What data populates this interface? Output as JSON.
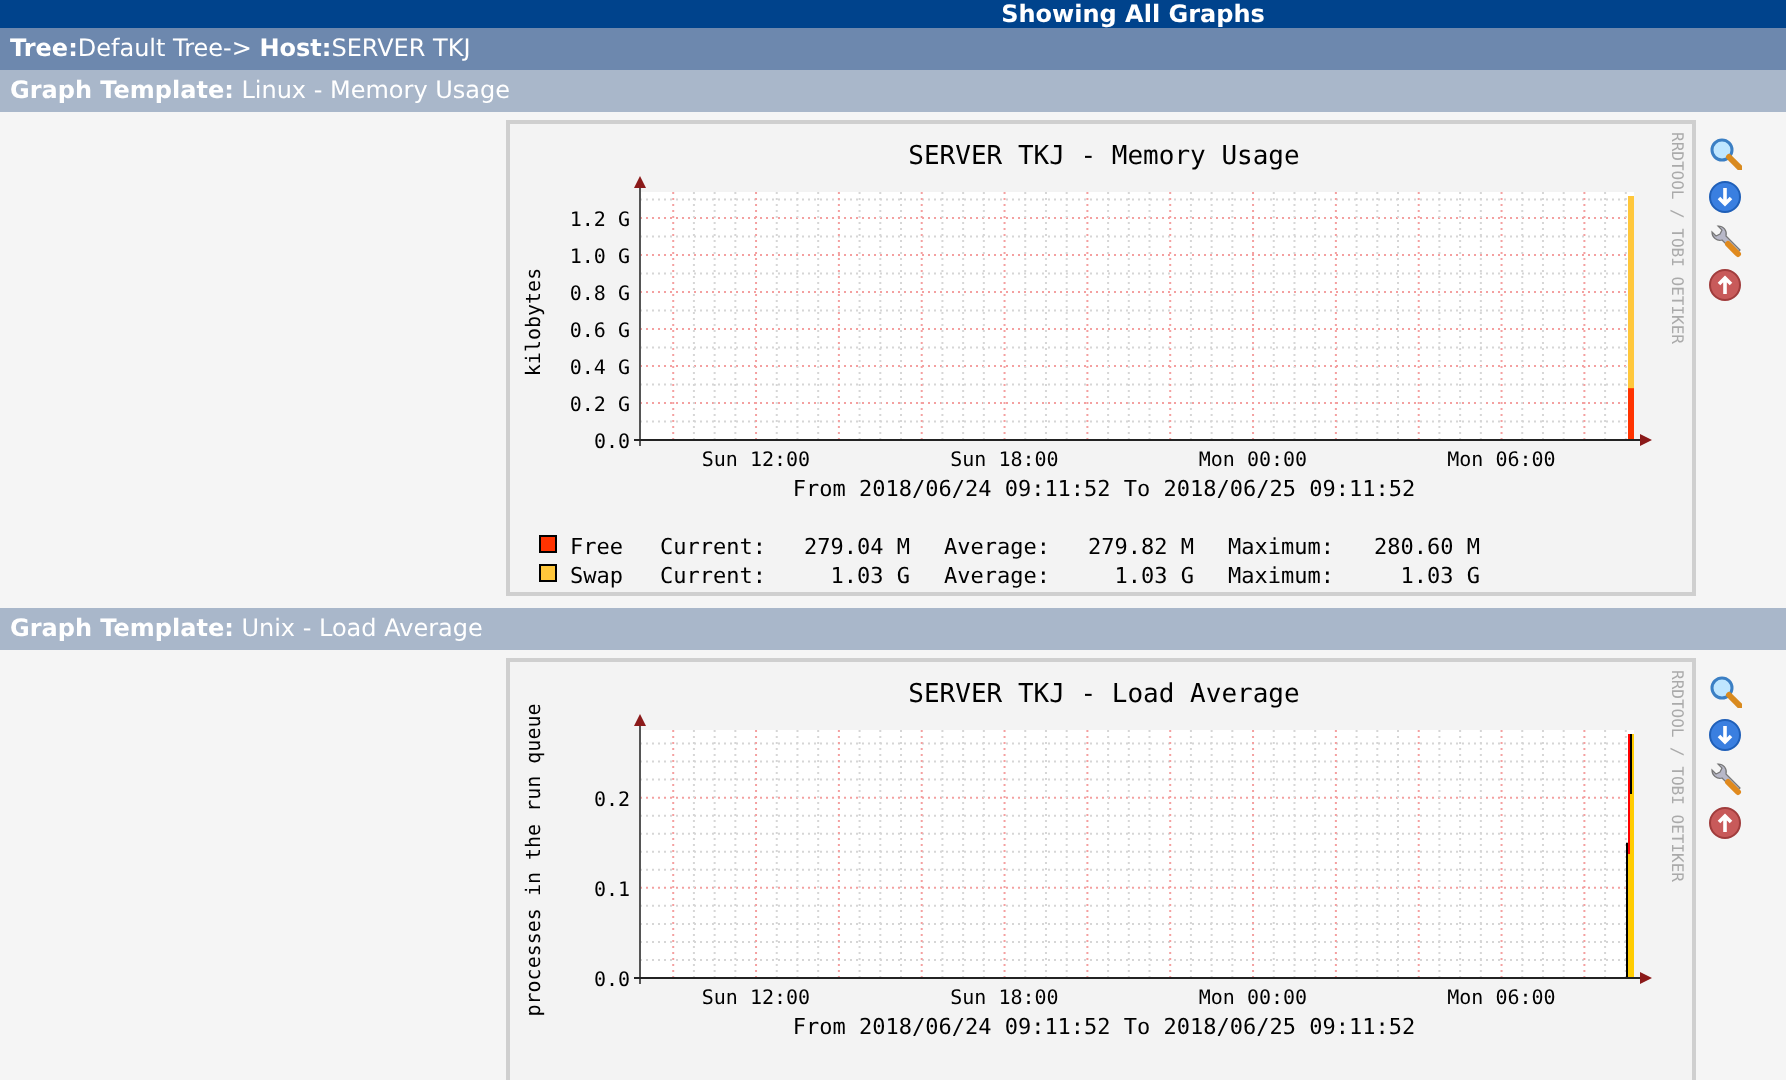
{
  "header": {
    "title": "Showing All Graphs"
  },
  "breadcrumb": "**Tree:**Default Tree-> **Host:**SERVER TKJ",
  "templates": [
    {
      "heading": "**Graph Template:** Linux - Memory Usage",
      "graph": {
        "title": "SERVER TKJ - Memory Usage",
        "ylabel": "kilobytes",
        "yticks": [
          "1.2 G",
          "1.0 G",
          "0.8 G",
          "0.6 G",
          "0.4 G",
          "0.2 G",
          "0.0"
        ],
        "xticks": [
          "Sun 12:00",
          "Sun 18:00",
          "Mon 00:00",
          "Mon 06:00"
        ],
        "range": "From 2018/06/24 09:11:52 To 2018/06/25 09:11:52",
        "side_text": "RRDTOOL / TOBI OETIKER",
        "legend": [
          {
            "name": "Free",
            "color": "#ff3300",
            "current_label": "Current:",
            "current": "279.04 M",
            "average_label": "Average:",
            "average": "279.82 M",
            "maximum_label": "Maximum:",
            "maximum": "280.60 M"
          },
          {
            "name": "Swap",
            "color": "#ffc73b",
            "current_label": "Current:",
            "current": "1.03 G",
            "average_label": "Average:",
            "average": "1.03 G",
            "maximum_label": "Maximum:",
            "maximum": "1.03 G"
          }
        ]
      }
    },
    {
      "heading": "**Graph Template:** Unix - Load Average",
      "graph": {
        "title": "SERVER TKJ - Load Average",
        "ylabel": "processes in the run queue",
        "yticks": [
          "0.2",
          "0.1",
          "0.0"
        ],
        "xticks": [
          "Sun 12:00",
          "Sun 18:00",
          "Mon 00:00",
          "Mon 06:00"
        ],
        "range": "From 2018/06/24 09:11:52 To 2018/06/25 09:11:52",
        "side_text": "RRDTOOL / TOBI OETIKER"
      }
    }
  ]
}
